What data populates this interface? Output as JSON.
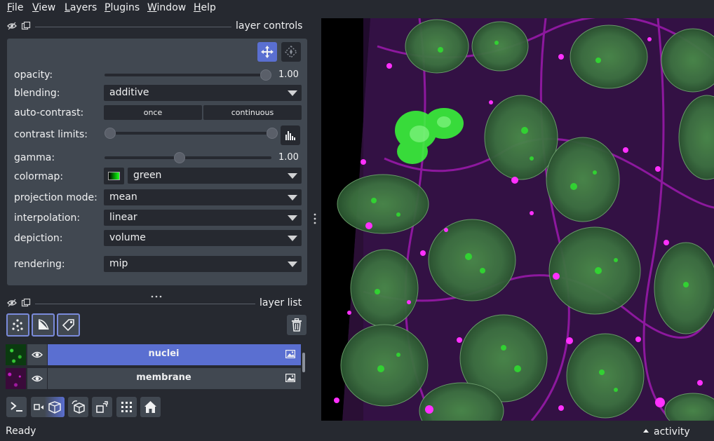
{
  "menu": {
    "items": [
      {
        "label_underlined": "F",
        "label_rest": "ile"
      },
      {
        "label_underlined": "V",
        "label_rest": "iew"
      },
      {
        "label_underlined": "L",
        "label_rest": "ayers"
      },
      {
        "label_underlined": "P",
        "label_rest": "lugins"
      },
      {
        "label_underlined": "W",
        "label_rest": "indow"
      },
      {
        "label_underlined": "H",
        "label_rest": "elp"
      }
    ]
  },
  "layer_controls": {
    "title": "layer controls",
    "opacity": {
      "label": "opacity:",
      "value": "1.00",
      "fraction": 1.0
    },
    "blending": {
      "label": "blending:",
      "value": "additive"
    },
    "auto_contrast": {
      "label": "auto-contrast:",
      "once": "once",
      "continuous": "continuous"
    },
    "contrast_limits": {
      "label": "contrast limits:",
      "low": 0.0,
      "high": 1.0
    },
    "gamma": {
      "label": "gamma:",
      "value": "1.00",
      "fraction": 0.45
    },
    "colormap": {
      "label": "colormap:",
      "value": "green"
    },
    "projection_mode": {
      "label": "projection mode:",
      "value": "mean"
    },
    "interpolation": {
      "label": "interpolation:",
      "value": "linear"
    },
    "depiction": {
      "label": "depiction:",
      "value": "volume"
    },
    "rendering": {
      "label": "rendering:",
      "value": "mip"
    }
  },
  "layer_list": {
    "title": "layer list",
    "layers": [
      {
        "name": "nuclei",
        "selected": true
      },
      {
        "name": "membrane",
        "selected": false
      }
    ]
  },
  "status": {
    "message": "Ready",
    "activity": "activity"
  },
  "colors": {
    "background": "#262930",
    "panel": "#414851",
    "accent": "#5a6fd1",
    "highlight": "#7a8bdb",
    "nuclei": "#2bd12b",
    "membrane": "#e020e0"
  }
}
